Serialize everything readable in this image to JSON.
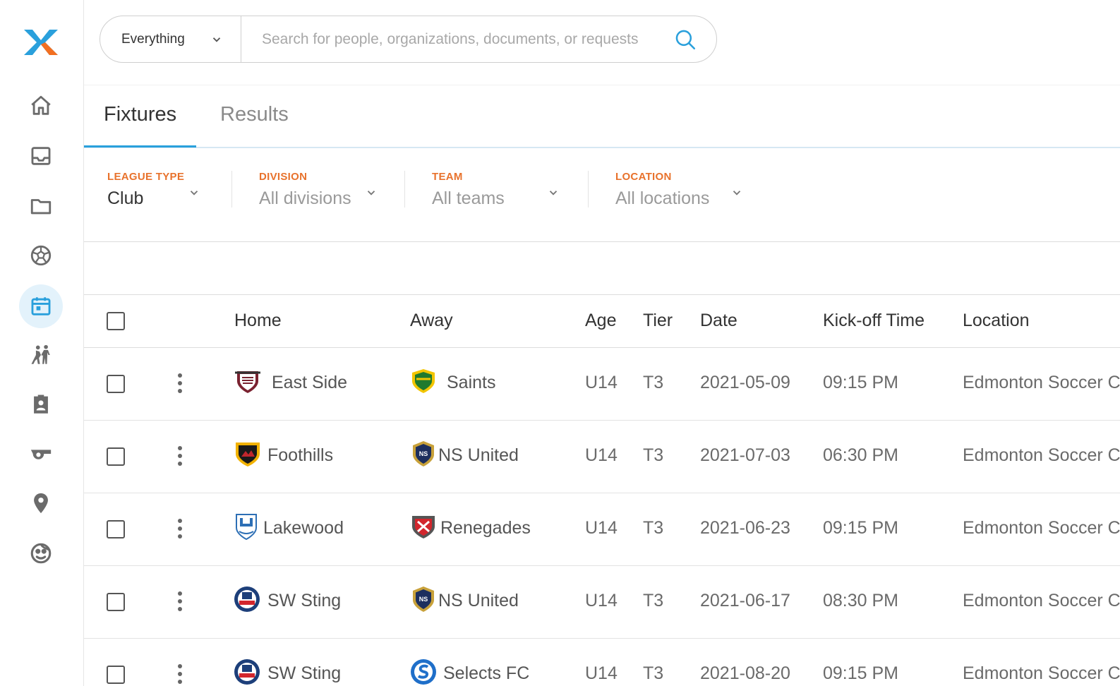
{
  "search": {
    "scope": "Everything",
    "placeholder": "Search for people, organizations, documents, or requests",
    "value": ""
  },
  "sidebar": {
    "items": [
      {
        "icon": "home-icon"
      },
      {
        "icon": "inbox-icon"
      },
      {
        "icon": "folder-icon"
      },
      {
        "icon": "soccer-ball-icon"
      },
      {
        "icon": "calendar-icon",
        "active": true
      },
      {
        "icon": "players-icon"
      },
      {
        "icon": "id-badge-icon"
      },
      {
        "icon": "whistle-icon"
      },
      {
        "icon": "location-pin-icon"
      },
      {
        "icon": "face-icon"
      }
    ]
  },
  "tabs": [
    {
      "label": "Fixtures",
      "active": true
    },
    {
      "label": "Results",
      "active": false
    }
  ],
  "filters": [
    {
      "label": "LEAGUE TYPE",
      "value": "Club"
    },
    {
      "label": "DIVISION",
      "value": "All divisions"
    },
    {
      "label": "TEAM",
      "value": "All teams"
    },
    {
      "label": "LOCATION",
      "value": "All locations"
    }
  ],
  "table": {
    "columns": [
      "Home",
      "Away",
      "Age",
      "Tier",
      "Date",
      "Kick-off Time",
      "Location"
    ],
    "rows": [
      {
        "home": "East Side",
        "away": "Saints",
        "age": "U14",
        "tier": "T3",
        "date": "2021-05-09",
        "time": "09:15 PM",
        "location": "Edmonton Soccer C"
      },
      {
        "home": "Foothills",
        "away": "NS United",
        "age": "U14",
        "tier": "T3",
        "date": "2021-07-03",
        "time": "06:30 PM",
        "location": "Edmonton Soccer C"
      },
      {
        "home": "Lakewood",
        "away": "Renegades",
        "age": "U14",
        "tier": "T3",
        "date": "2021-06-23",
        "time": "09:15 PM",
        "location": "Edmonton Soccer C"
      },
      {
        "home": "SW Sting",
        "away": "NS United",
        "age": "U14",
        "tier": "T3",
        "date": "2021-06-17",
        "time": "08:30 PM",
        "location": "Edmonton Soccer C"
      },
      {
        "home": "SW Sting",
        "away": "Selects FC",
        "age": "U14",
        "tier": "T3",
        "date": "2021-08-20",
        "time": "09:15 PM",
        "location": "Edmonton Soccer C"
      }
    ]
  },
  "colors": {
    "accent": "#2aa0dc",
    "filter_label": "#e8722c",
    "logo_blue": "#2aa0dc",
    "logo_orange": "#f26f21"
  }
}
